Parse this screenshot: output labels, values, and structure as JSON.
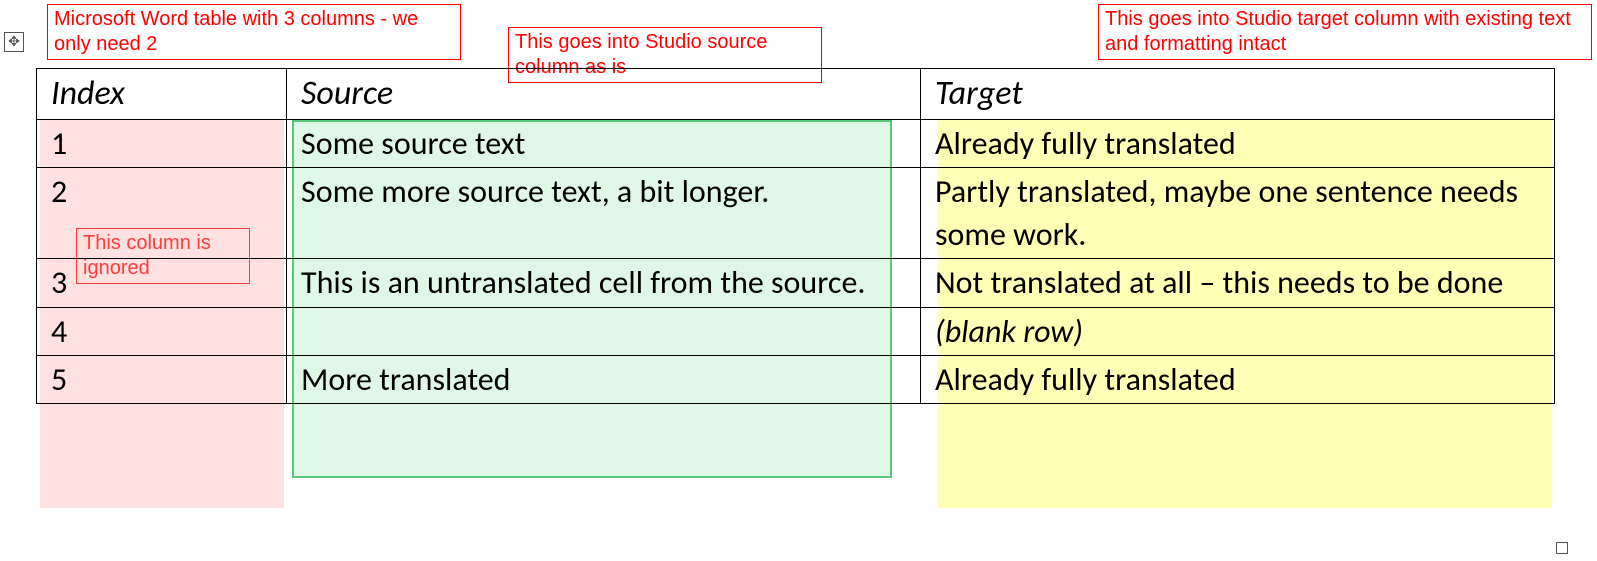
{
  "annotations": {
    "top_left": "Microsoft Word table with 3 columns - we only need 2",
    "source_note": "This goes into Studio source column as is",
    "target_note": "This goes into Studio target column with existing text and formatting intact",
    "index_note": "This column is ignored"
  },
  "table": {
    "headers": {
      "index": "Index",
      "source": "Source",
      "target": "Target"
    },
    "rows": [
      {
        "index": "1",
        "source": "Some source text",
        "target": "Already fully translated",
        "target_italic": false
      },
      {
        "index": "2",
        "source": "Some more source text, a bit longer.",
        "target": "Partly translated, maybe one sentence needs some work.",
        "target_italic": false
      },
      {
        "index": "3",
        "source": "This is an untranslated cell from the source.",
        "target": "Not translated at all – this needs to be done",
        "target_italic": false
      },
      {
        "index": "4",
        "source": "",
        "target": "(blank row)",
        "target_italic": true
      },
      {
        "index": "5",
        "source": "More translated",
        "target": "Already fully translated",
        "target_italic": false
      }
    ]
  }
}
